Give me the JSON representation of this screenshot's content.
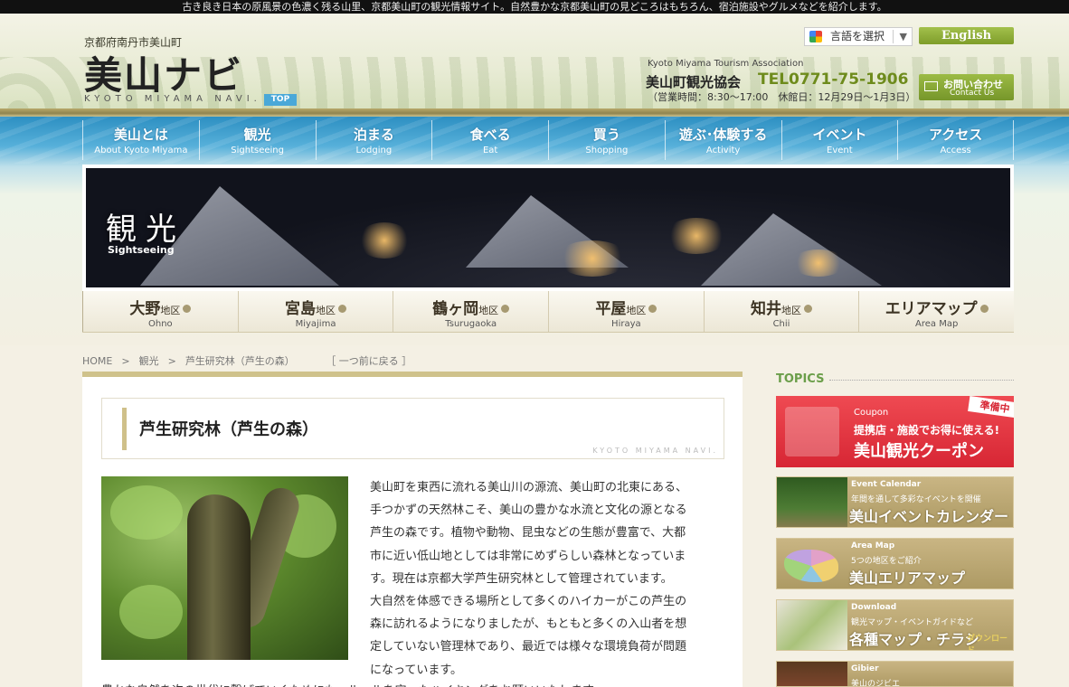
{
  "topbar": {
    "tagline": "古き良き日本の原風景の色濃く残る山里、京都美山町の観光情報サイト。自然豊かな京都美山町の見どころはもちろん、宿泊施設やグルメなどを紹介します。"
  },
  "header": {
    "location": "京都府南丹市美山町",
    "logo": "美山ナビ",
    "logo_sub": "KYOTO MIYAMA NAVI.",
    "top_badge": "TOP",
    "language_select": "言語を選択",
    "english_button": "English",
    "association_en": "Kyoto Miyama Tourism Association",
    "association_ja": "美山町観光協会",
    "tel": "TEL0771-75-1906",
    "hours": "（営業時間：8:30〜17:00　休館日：12月29日〜1月3日）",
    "contact_ja": "お問い合わせ",
    "contact_en": "Contact Us"
  },
  "nav": [
    {
      "ja": "美山とは",
      "en": "About Kyoto Miyama"
    },
    {
      "ja": "観光",
      "en": "Sightseeing"
    },
    {
      "ja": "泊まる",
      "en": "Lodging"
    },
    {
      "ja": "食べる",
      "en": "Eat"
    },
    {
      "ja": "買う",
      "en": "Shopping"
    },
    {
      "ja": "遊ぶ･体験する",
      "en": "Activity"
    },
    {
      "ja": "イベント",
      "en": "Event"
    },
    {
      "ja": "アクセス",
      "en": "Access"
    }
  ],
  "hero": {
    "title": "観光",
    "subtitle": "Sightseeing"
  },
  "areas": [
    {
      "name": "大野",
      "suffix": "地区",
      "en": "Ohno"
    },
    {
      "name": "宮島",
      "suffix": "地区",
      "en": "Miyajima"
    },
    {
      "name": "鶴ヶ岡",
      "suffix": "地区",
      "en": "Tsurugaoka"
    },
    {
      "name": "平屋",
      "suffix": "地区",
      "en": "Hiraya"
    },
    {
      "name": "知井",
      "suffix": "地区",
      "en": "Chii"
    },
    {
      "name": "エリアマップ",
      "suffix": "",
      "en": "Area Map"
    }
  ],
  "breadcrumb": {
    "home": "HOME",
    "sep": ">",
    "section": "観光",
    "current": "芦生研究林（芦生の森）",
    "back": "［ 一つ前に戻る ］"
  },
  "article": {
    "title": "芦生研究林（芦生の森）",
    "watermark": "KYOTO MIYAMA NAVI.",
    "lines": [
      "美山町を東西に流れる美山川の源流、美山町の北東にある、",
      "手つかずの天然林こそ、美山の豊かな水流と文化の源となる",
      "芦生の森です。植物や動物、昆虫などの生態が豊富で、大都",
      "市に近い低山地としては非常にめずらしい森林となっていま",
      "す。現在は京都大学芦生研究林として管理されています。",
      "大自然を体感できる場所として多くのハイカーがこの芦生の",
      "森に訪れるようになりましたが、もともと多くの入山者を想",
      "定していない管理林であり、最近では様々な環境負荷が問題",
      "になっています。"
    ],
    "continued": "豊かな自然を次の世代に繋げていくためにも、ルールを守ったハイキングをお願いいたします。"
  },
  "topics": {
    "heading": "TOPICS",
    "coupon": {
      "en": "Coupon",
      "badge": "準備中",
      "line1": "提携店・施設でお得に使える!",
      "line2": "美山観光クーポン"
    },
    "event": {
      "en": "Event Calendar",
      "line1": "年間を通して多彩なイベントを開催",
      "line2": "美山イベントカレンダー"
    },
    "area": {
      "en": "Area Map",
      "line1": "5つの地区をご紹介",
      "line2": "美山エリアマップ"
    },
    "download": {
      "en": "Download",
      "line1": "観光マップ・イベントガイドなど",
      "line2": "各種マップ・チラシ",
      "tag": "ダウンロード"
    },
    "gibier": {
      "en": "Gibier",
      "line1": "美山のジビエ"
    }
  },
  "colors": {
    "nav_blue": "#2d8fc2",
    "accent_green": "#7e9d2a",
    "coupon_red": "#d72634",
    "banner_tan": "#ad9a64"
  }
}
